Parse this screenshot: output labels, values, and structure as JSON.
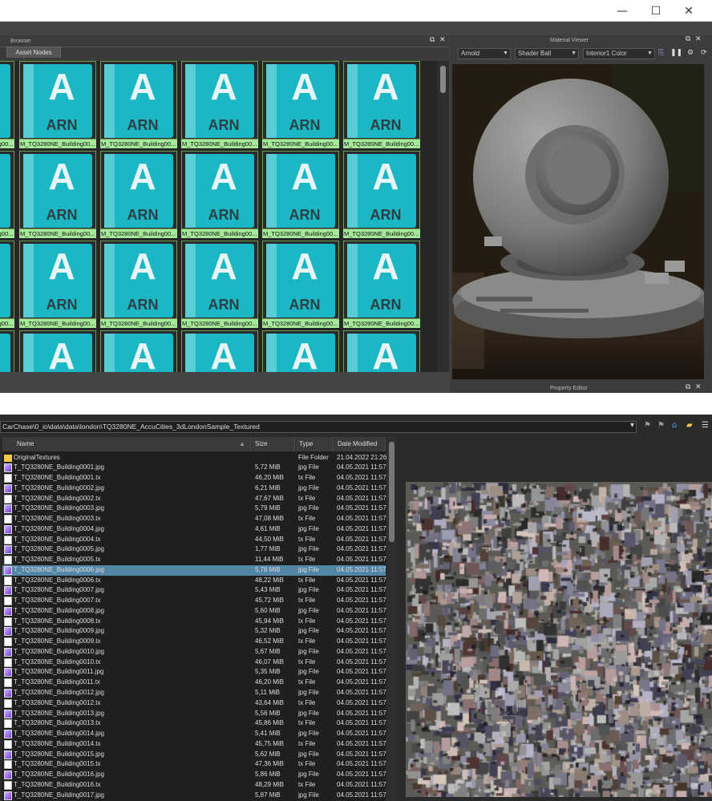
{
  "window": {
    "minimize_icon": "—",
    "maximize_icon": "☐",
    "close_icon": "✕"
  },
  "browser": {
    "title": "Browser",
    "tab": "Asset Nodes",
    "tile_label": "M_TQ3280NE_Building00...",
    "tile_letter": "A",
    "tile_text": "ARN"
  },
  "material_viewer": {
    "title": "Material Viewer",
    "renderer": "Arnold",
    "geometry": "Shader Ball",
    "environment": "Interior1 Color",
    "footer": "Property Editor"
  },
  "file_browser": {
    "path": "CarChase\\0_io\\data\\data\\london\\TQ3280NE_AccuCities_3dLondonSample_Textured",
    "columns": {
      "name": "Name",
      "size": "Size",
      "type": "Type",
      "date": "Date Modified"
    },
    "rows": [
      {
        "icon": "folder",
        "name": "OriginalTextures",
        "size": "",
        "type": "File Folder",
        "date": "21.04.2022 21:26"
      },
      {
        "icon": "jpg",
        "name": "T_TQ3280NE_Building0001.jpg",
        "size": "5,72 MiB",
        "type": "jpg File",
        "date": "04.05.2021 11:57"
      },
      {
        "icon": "tx",
        "name": "T_TQ3280NE_Building0001.tx",
        "size": "46,20 MiB",
        "type": "tx File",
        "date": "04.05.2021 11:57"
      },
      {
        "icon": "jpg",
        "name": "T_TQ3280NE_Building0002.jpg",
        "size": "6,21 MiB",
        "type": "jpg File",
        "date": "04.05.2021 11:57"
      },
      {
        "icon": "tx",
        "name": "T_TQ3280NE_Building0002.tx",
        "size": "47,67 MiB",
        "type": "tx File",
        "date": "04.05.2021 11:57"
      },
      {
        "icon": "jpg",
        "name": "T_TQ3280NE_Building0003.jpg",
        "size": "5,79 MiB",
        "type": "jpg File",
        "date": "04.05.2021 11:57"
      },
      {
        "icon": "tx",
        "name": "T_TQ3280NE_Building0003.tx",
        "size": "47,08 MiB",
        "type": "tx File",
        "date": "04.05.2021 11:57"
      },
      {
        "icon": "jpg",
        "name": "T_TQ3280NE_Building0004.jpg",
        "size": "4,61 MiB",
        "type": "jpg File",
        "date": "04.05.2021 11:57"
      },
      {
        "icon": "tx",
        "name": "T_TQ3280NE_Building0004.tx",
        "size": "44,50 MiB",
        "type": "tx File",
        "date": "04.05.2021 11:57"
      },
      {
        "icon": "jpg",
        "name": "T_TQ3280NE_Building0005.jpg",
        "size": "1,77 MiB",
        "type": "jpg File",
        "date": "04.05.2021 11:57"
      },
      {
        "icon": "tx",
        "name": "T_TQ3280NE_Building0005.tx",
        "size": "11,44 MiB",
        "type": "tx File",
        "date": "04.05.2021 11:57"
      },
      {
        "icon": "jpg",
        "name": "T_TQ3280NE_Building0006.jpg",
        "size": "5,76 MiB",
        "type": "jpg File",
        "date": "04.05.2021 11:57",
        "selected": true
      },
      {
        "icon": "tx",
        "name": "T_TQ3280NE_Building0006.tx",
        "size": "48,22 MiB",
        "type": "tx File",
        "date": "04.05.2021 11:57"
      },
      {
        "icon": "jpg",
        "name": "T_TQ3280NE_Building0007.jpg",
        "size": "5,43 MiB",
        "type": "jpg File",
        "date": "04.05.2021 11:57"
      },
      {
        "icon": "tx",
        "name": "T_TQ3280NE_Building0007.tx",
        "size": "45,72 MiB",
        "type": "tx File",
        "date": "04.05.2021 11:57"
      },
      {
        "icon": "jpg",
        "name": "T_TQ3280NE_Building0008.jpg",
        "size": "5,60 MiB",
        "type": "jpg File",
        "date": "04.05.2021 11:57"
      },
      {
        "icon": "tx",
        "name": "T_TQ3280NE_Building0008.tx",
        "size": "45,94 MiB",
        "type": "tx File",
        "date": "04.05.2021 11:57"
      },
      {
        "icon": "jpg",
        "name": "T_TQ3280NE_Building0009.jpg",
        "size": "5,32 MiB",
        "type": "jpg File",
        "date": "04.05.2021 11:57"
      },
      {
        "icon": "tx",
        "name": "T_TQ3280NE_Building0009.tx",
        "size": "46,52 MiB",
        "type": "tx File",
        "date": "04.05.2021 11:57"
      },
      {
        "icon": "jpg",
        "name": "T_TQ3280NE_Building0010.jpg",
        "size": "5,67 MiB",
        "type": "jpg File",
        "date": "04.05.2021 11:57"
      },
      {
        "icon": "tx",
        "name": "T_TQ3280NE_Building0010.tx",
        "size": "46,07 MiB",
        "type": "tx File",
        "date": "04.05.2021 11:57"
      },
      {
        "icon": "jpg",
        "name": "T_TQ3280NE_Building0011.jpg",
        "size": "5,35 MiB",
        "type": "jpg File",
        "date": "04.05.2021 11:57"
      },
      {
        "icon": "tx",
        "name": "T_TQ3280NE_Building0011.tx",
        "size": "46,20 MiB",
        "type": "tx File",
        "date": "04.05.2021 11:57"
      },
      {
        "icon": "jpg",
        "name": "T_TQ3280NE_Building0012.jpg",
        "size": "5,11 MiB",
        "type": "jpg File",
        "date": "04.05.2021 11:57"
      },
      {
        "icon": "tx",
        "name": "T_TQ3280NE_Building0012.tx",
        "size": "43,64 MiB",
        "type": "tx File",
        "date": "04.05.2021 11:57"
      },
      {
        "icon": "jpg",
        "name": "T_TQ3280NE_Building0013.jpg",
        "size": "5,56 MiB",
        "type": "jpg File",
        "date": "04.05.2021 11:57"
      },
      {
        "icon": "tx",
        "name": "T_TQ3280NE_Building0013.tx",
        "size": "45,86 MiB",
        "type": "tx File",
        "date": "04.05.2021 11:57"
      },
      {
        "icon": "jpg",
        "name": "T_TQ3280NE_Building0014.jpg",
        "size": "5,41 MiB",
        "type": "jpg File",
        "date": "04.05.2021 11:57"
      },
      {
        "icon": "tx",
        "name": "T_TQ3280NE_Building0014.tx",
        "size": "45,75 MiB",
        "type": "tx File",
        "date": "04.05.2021 11:57"
      },
      {
        "icon": "jpg",
        "name": "T_TQ3280NE_Building0015.jpg",
        "size": "5,62 MiB",
        "type": "jpg File",
        "date": "04.05.2021 11:57"
      },
      {
        "icon": "tx",
        "name": "T_TQ3280NE_Building0015.tx",
        "size": "47,36 MiB",
        "type": "tx File",
        "date": "04.05.2021 11:57"
      },
      {
        "icon": "jpg",
        "name": "T_TQ3280NE_Building0016.jpg",
        "size": "5,86 MiB",
        "type": "jpg File",
        "date": "04.05.2021 11:57"
      },
      {
        "icon": "tx",
        "name": "T_TQ3280NE_Building0016.tx",
        "size": "48,29 MiB",
        "type": "tx File",
        "date": "04.05.2021 11:57"
      },
      {
        "icon": "jpg",
        "name": "T_TQ3280NE_Building0017.jpg",
        "size": "5,87 MiB",
        "type": "jpg File",
        "date": "04.05.2021 11:57"
      }
    ]
  }
}
